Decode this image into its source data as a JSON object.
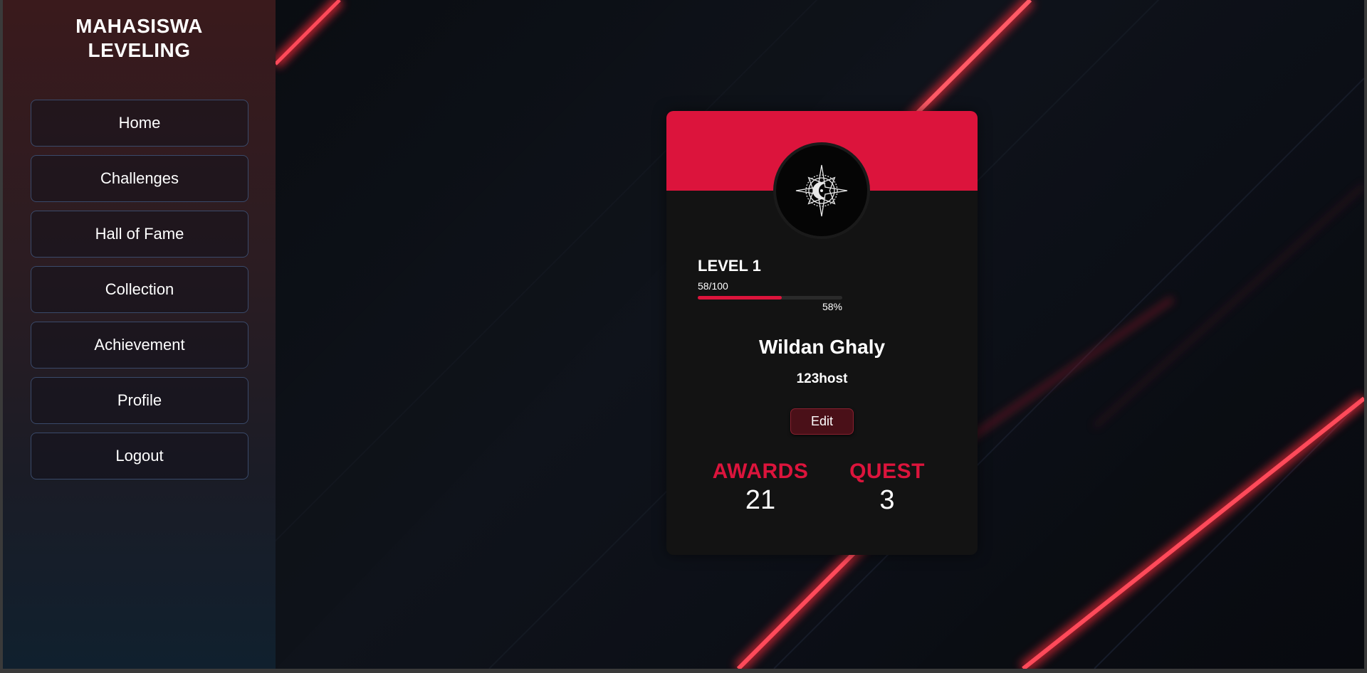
{
  "app": {
    "brand_line1": "MAHASISWA",
    "brand_line2": "LEVELING"
  },
  "sidebar": {
    "items": [
      {
        "label": "Home"
      },
      {
        "label": "Challenges"
      },
      {
        "label": "Hall of Fame"
      },
      {
        "label": "Collection"
      },
      {
        "label": "Achievement"
      },
      {
        "label": "Profile"
      },
      {
        "label": "Logout"
      }
    ]
  },
  "profile": {
    "level_label": "LEVEL 1",
    "xp_text": "58/100",
    "xp_percent_text": "58%",
    "xp_fraction": 0.58,
    "name": "Wildan Ghaly",
    "username": "123host",
    "edit_label": "Edit",
    "avatar_icon": "compass-emblem-icon"
  },
  "stats": {
    "awards_label": "AWARDS",
    "awards_value": "21",
    "quest_label": "QUEST",
    "quest_value": "3"
  },
  "colors": {
    "accent": "#dc143c",
    "card_bg": "#131313",
    "edit_bg": "#4a1018"
  }
}
